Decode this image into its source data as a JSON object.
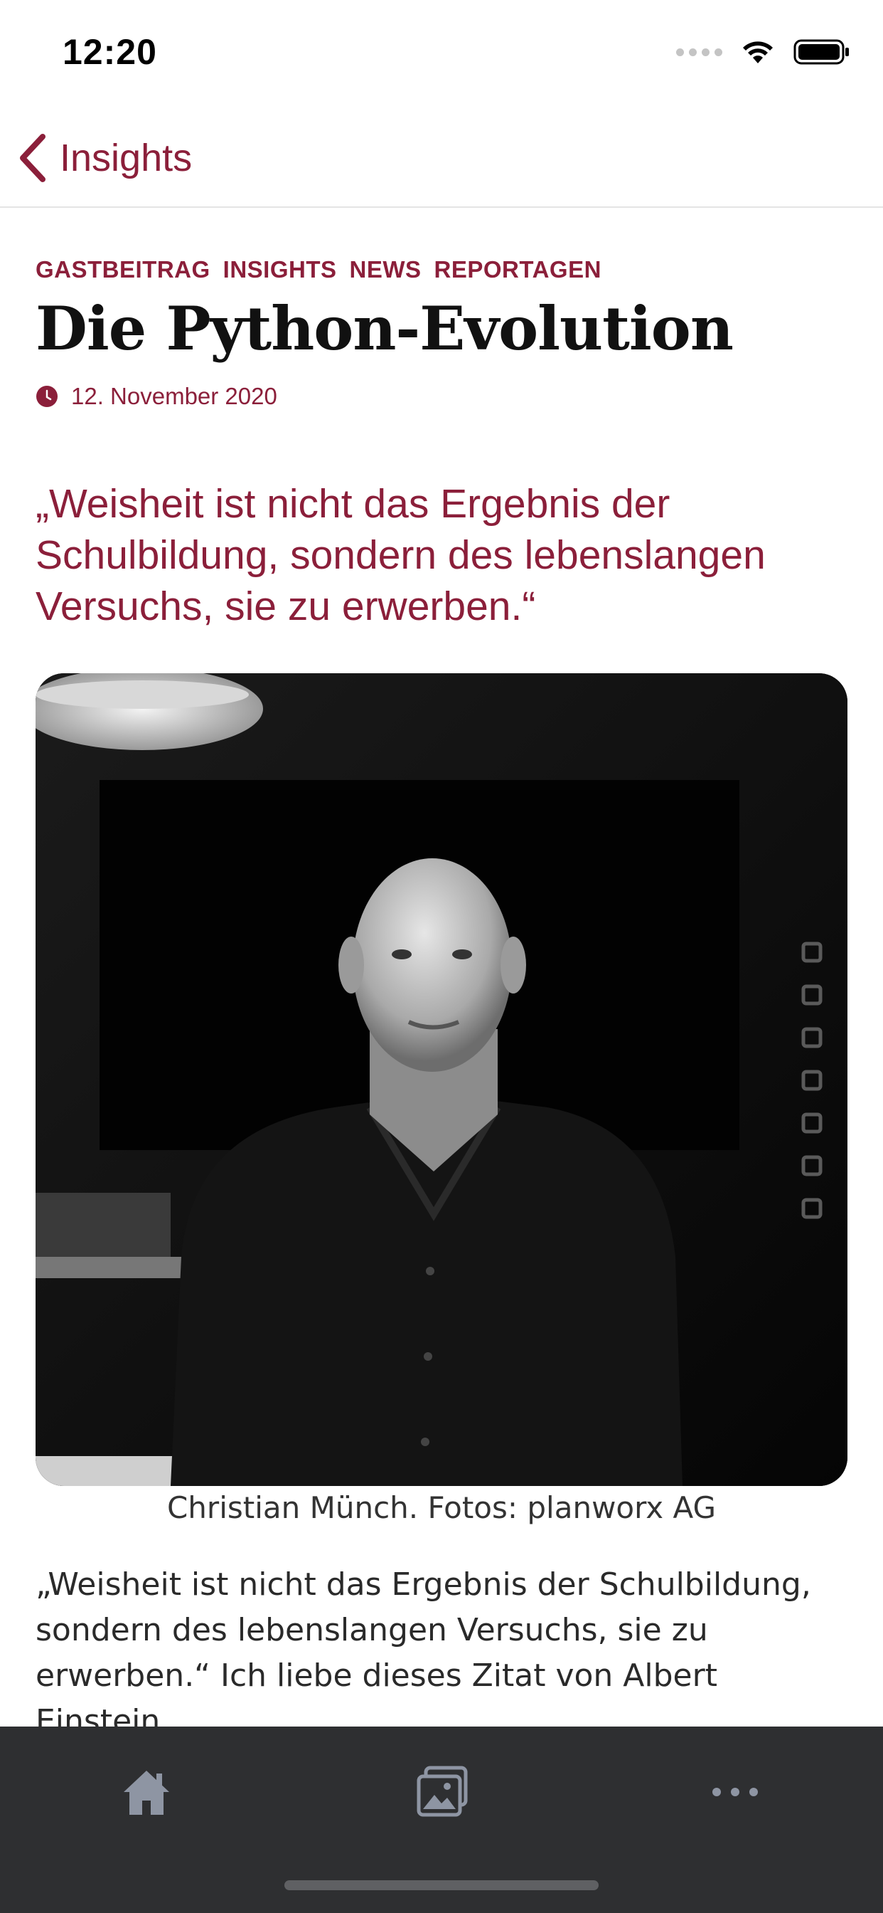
{
  "status_bar": {
    "time": "12:20"
  },
  "nav": {
    "back_label": "Insights",
    "icons": [
      "chevron-left-icon"
    ]
  },
  "article": {
    "tags": [
      "GASTBEITRAG",
      "INSIGHTS",
      "NEWS",
      "REPORTAGEN"
    ],
    "title": "Die Python-Evolution",
    "date": "12. November 2020",
    "lead_quote": "„Weisheit ist nicht das Ergebnis der Schulbildung, sondern des lebenslangen Versuchs, sie zu erwerben.“",
    "photo_caption": "Christian Münch. Fotos: planworx AG",
    "body_text": "„Weisheit ist nicht das Ergebnis der Schulbildung, sondern des lebenslangen Versuchs, sie zu erwerben.“ Ich liebe dieses Zitat von Albert Einstein,"
  },
  "tab_bar": {
    "tabs": [
      "home-icon",
      "gallery-icon",
      "more-icon"
    ]
  },
  "colors": {
    "accent": "#8b1f3a",
    "tab_bar_bg": "#2e2f31",
    "tab_icon": "#8e95a3"
  }
}
